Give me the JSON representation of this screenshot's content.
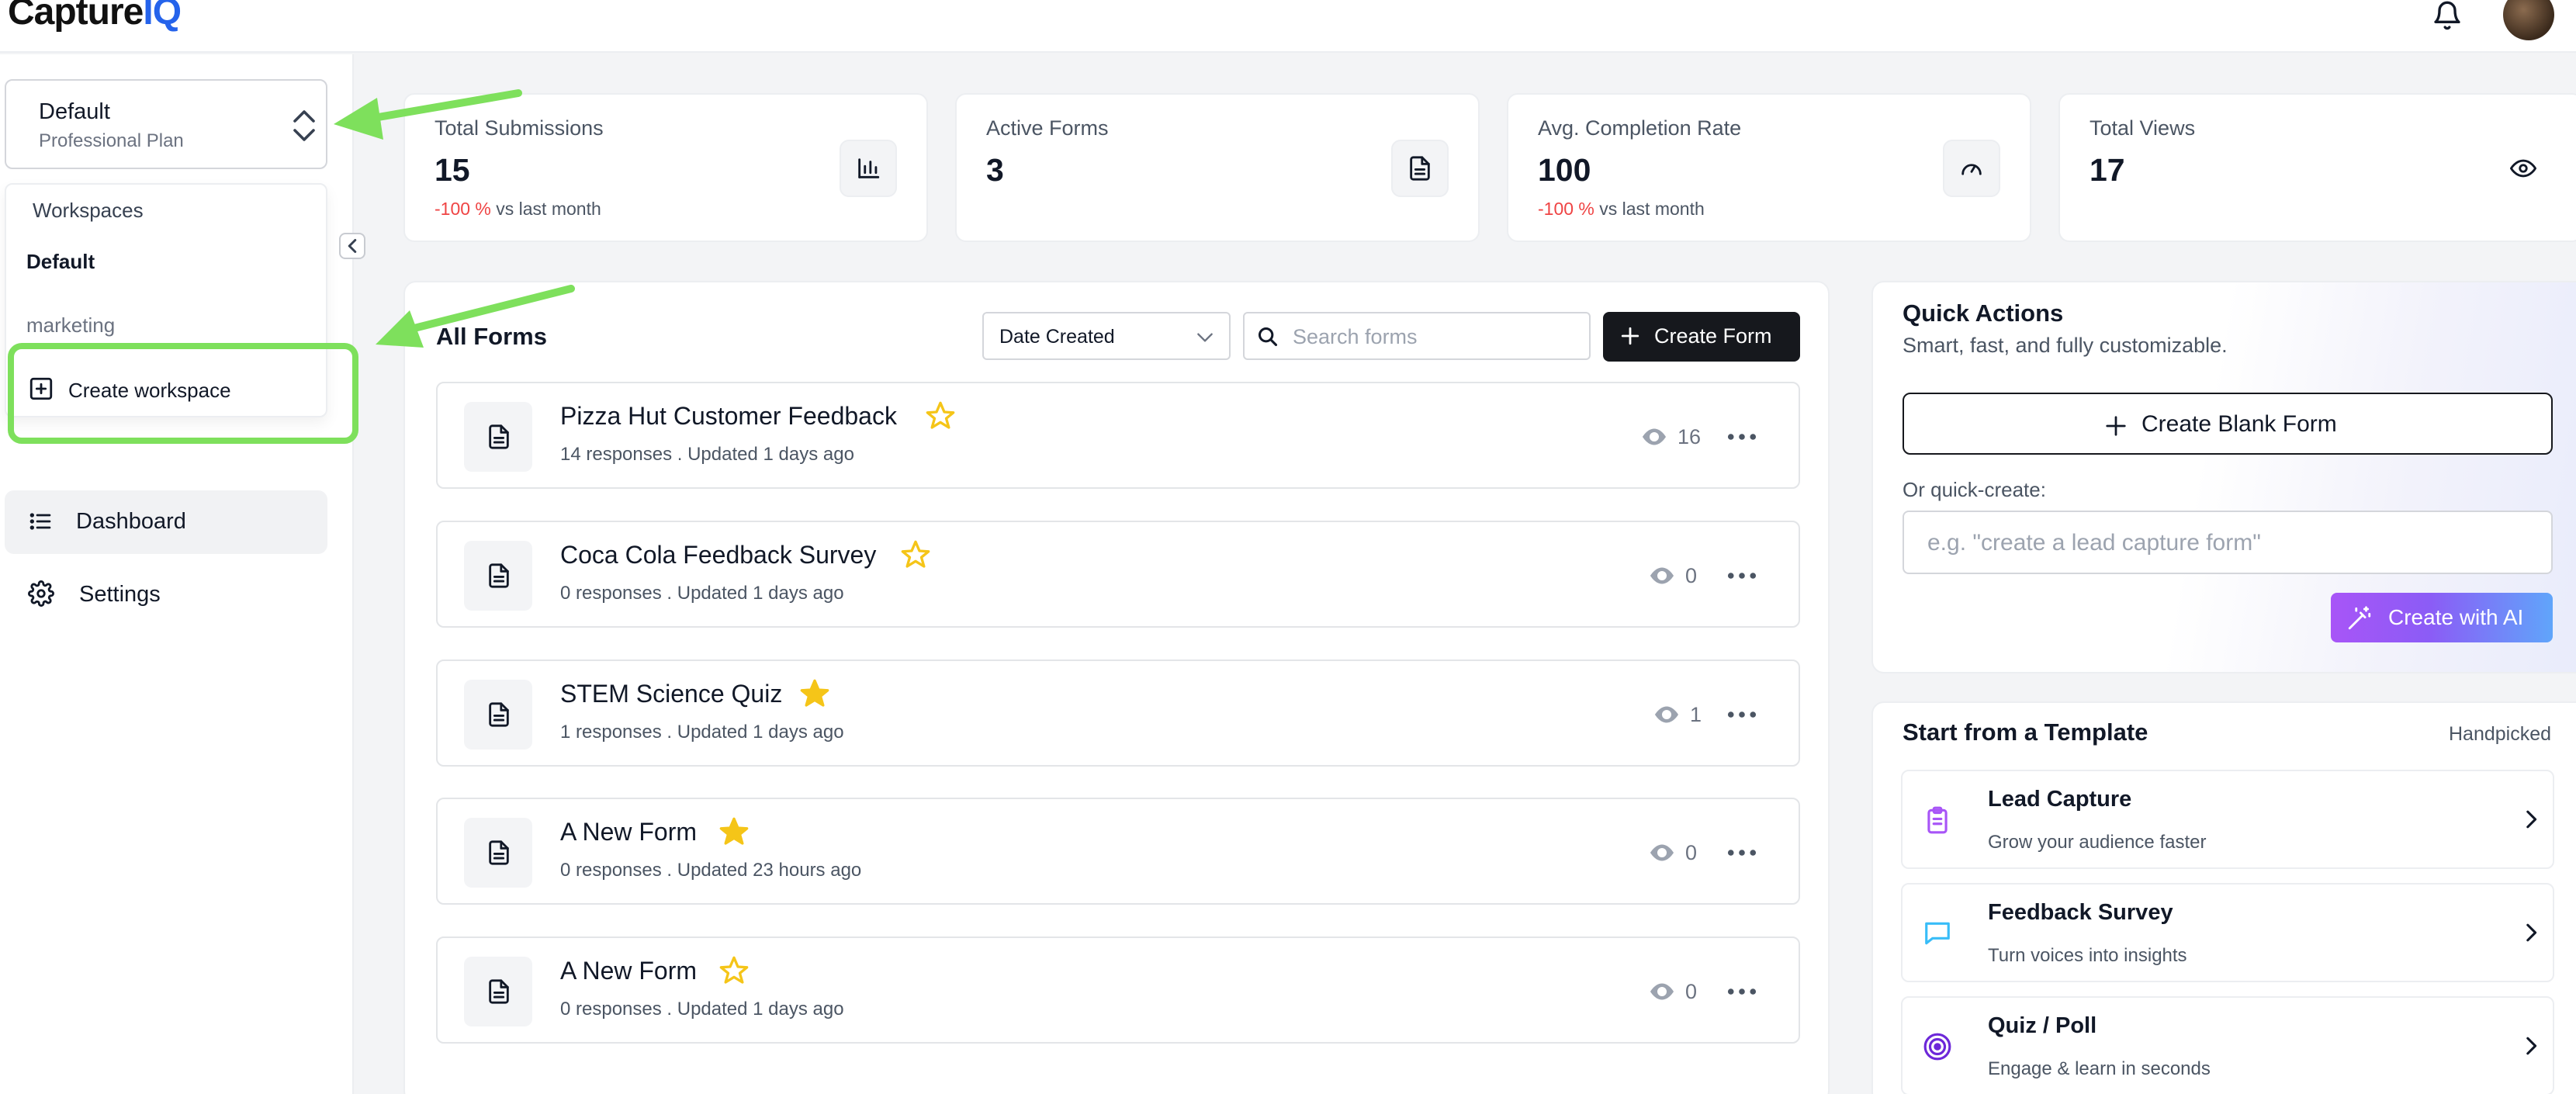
{
  "app": {
    "logo_main": "Capture",
    "logo_accent": "IQ"
  },
  "header": {
    "bell_icon": "bell-icon",
    "avatar": "user-avatar"
  },
  "sidebar": {
    "workspace_selector": {
      "name": "Default",
      "plan": "Professional Plan"
    },
    "workspace_menu": {
      "header": "Workspaces",
      "items": [
        "Default",
        "marketing"
      ],
      "create_label": "Create workspace"
    },
    "nav": [
      {
        "label": "Dashboard",
        "icon": "list-icon",
        "active": true
      },
      {
        "label": "Settings",
        "icon": "gear-icon",
        "active": false
      }
    ]
  },
  "stats": [
    {
      "title": "Total Submissions",
      "value": "15",
      "delta": "-100 %",
      "delta_suffix": "vs last month",
      "icon": "bar-chart-icon"
    },
    {
      "title": "Active Forms",
      "value": "3",
      "delta": "",
      "delta_suffix": "",
      "icon": "document-icon"
    },
    {
      "title": "Avg. Completion Rate",
      "value": "100",
      "delta": "-100 %",
      "delta_suffix": "vs last month",
      "icon": "gauge-icon"
    },
    {
      "title": "Total Views",
      "value": "17",
      "delta": "",
      "delta_suffix": "",
      "icon": "eye-icon"
    }
  ],
  "forms": {
    "title": "All Forms",
    "sort_value": "Date Created",
    "search_placeholder": "Search forms",
    "create_label": "Create Form",
    "rows": [
      {
        "name": "Pizza Hut Customer Feedback",
        "starred": false,
        "meta": "14 responses . Updated 1 days ago",
        "views": "16"
      },
      {
        "name": "Coca Cola Feedback Survey",
        "starred": false,
        "meta": "0 responses . Updated 1 days ago",
        "views": "0"
      },
      {
        "name": "STEM Science Quiz",
        "starred": true,
        "meta": "1 responses . Updated 1 days ago",
        "views": "1"
      },
      {
        "name": "A New Form",
        "starred": true,
        "meta": "0 responses . Updated 23 hours ago",
        "views": "0"
      },
      {
        "name": "A New Form",
        "starred": false,
        "meta": "0 responses . Updated 1 days ago",
        "views": "0"
      }
    ]
  },
  "quick_actions": {
    "title": "Quick Actions",
    "subtitle": "Smart, fast, and fully customizable.",
    "blank_label": "Create Blank Form",
    "quick_label": "Or quick-create:",
    "quick_placeholder": "e.g. \"create a lead capture form\"",
    "ai_label": "Create with AI"
  },
  "templates": {
    "title": "Start from a Template",
    "tag": "Handpicked",
    "items": [
      {
        "name": "Lead Capture",
        "desc": "Grow your audience faster",
        "icon": "clipboard-icon",
        "color": "#a855f7"
      },
      {
        "name": "Feedback Survey",
        "desc": "Turn voices into insights",
        "icon": "chat-bubble-icon",
        "color": "#38bdf8"
      },
      {
        "name": "Quiz / Poll",
        "desc": "Engage & learn in seconds",
        "icon": "target-icon",
        "color": "#6d28d9"
      }
    ]
  },
  "colors": {
    "accent": "#2563eb",
    "star": "#f5c518",
    "negative": "#ef4444",
    "annotation_green": "#7ee05c"
  }
}
